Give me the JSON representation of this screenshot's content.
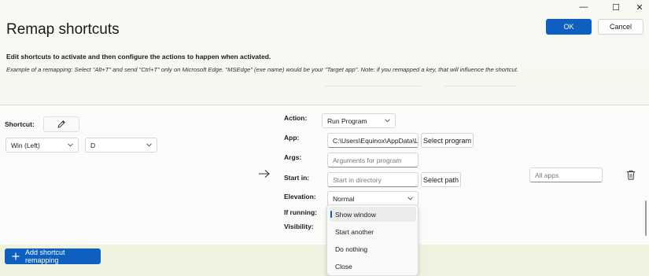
{
  "window": {
    "minimize_glyph": "—",
    "maximize_glyph": "☐",
    "close_glyph": "✕"
  },
  "header": {
    "title": "Remap shortcuts",
    "ok_label": "OK",
    "cancel_label": "Cancel"
  },
  "description": "Edit shortcuts to activate and then configure the actions to happen when activated.",
  "example": "Example of a remapping: Select \"Alt+T\" and send \"Ctrl+T\" only on Microsoft Edge. \"MSEdge\" (exe name) would be your \"Target app\". Note: if you remapped a key, that will influence the shortcut.",
  "row": {
    "shortcut_label": "Shortcut:",
    "key1": "Win (Left)",
    "key2": "D",
    "action_label": "Action:",
    "action_value": "Run Program",
    "app_label": "App:",
    "app_value": "C:\\Users\\Equinox\\AppData\\Lc",
    "select_program_label": "Select program",
    "args_label": "Args:",
    "args_placeholder": "Arguments for program",
    "start_in_label": "Start in:",
    "start_in_placeholder": "Start in directory",
    "select_path_label": "Select path",
    "elevation_label": "Elevation:",
    "elevation_value": "Normal",
    "if_running_label": "If running:",
    "visibility_label": "Visibility:",
    "target_app_placeholder": "All apps"
  },
  "if_running_options": [
    {
      "label": "Show window",
      "selected": true
    },
    {
      "label": "Start another",
      "selected": false
    },
    {
      "label": "Do nothing",
      "selected": false
    },
    {
      "label": "Close",
      "selected": false
    }
  ],
  "footer": {
    "add_label": "Add shortcut remapping"
  },
  "colors": {
    "accent": "#0f5fc0",
    "background": "#f3f7ec"
  }
}
